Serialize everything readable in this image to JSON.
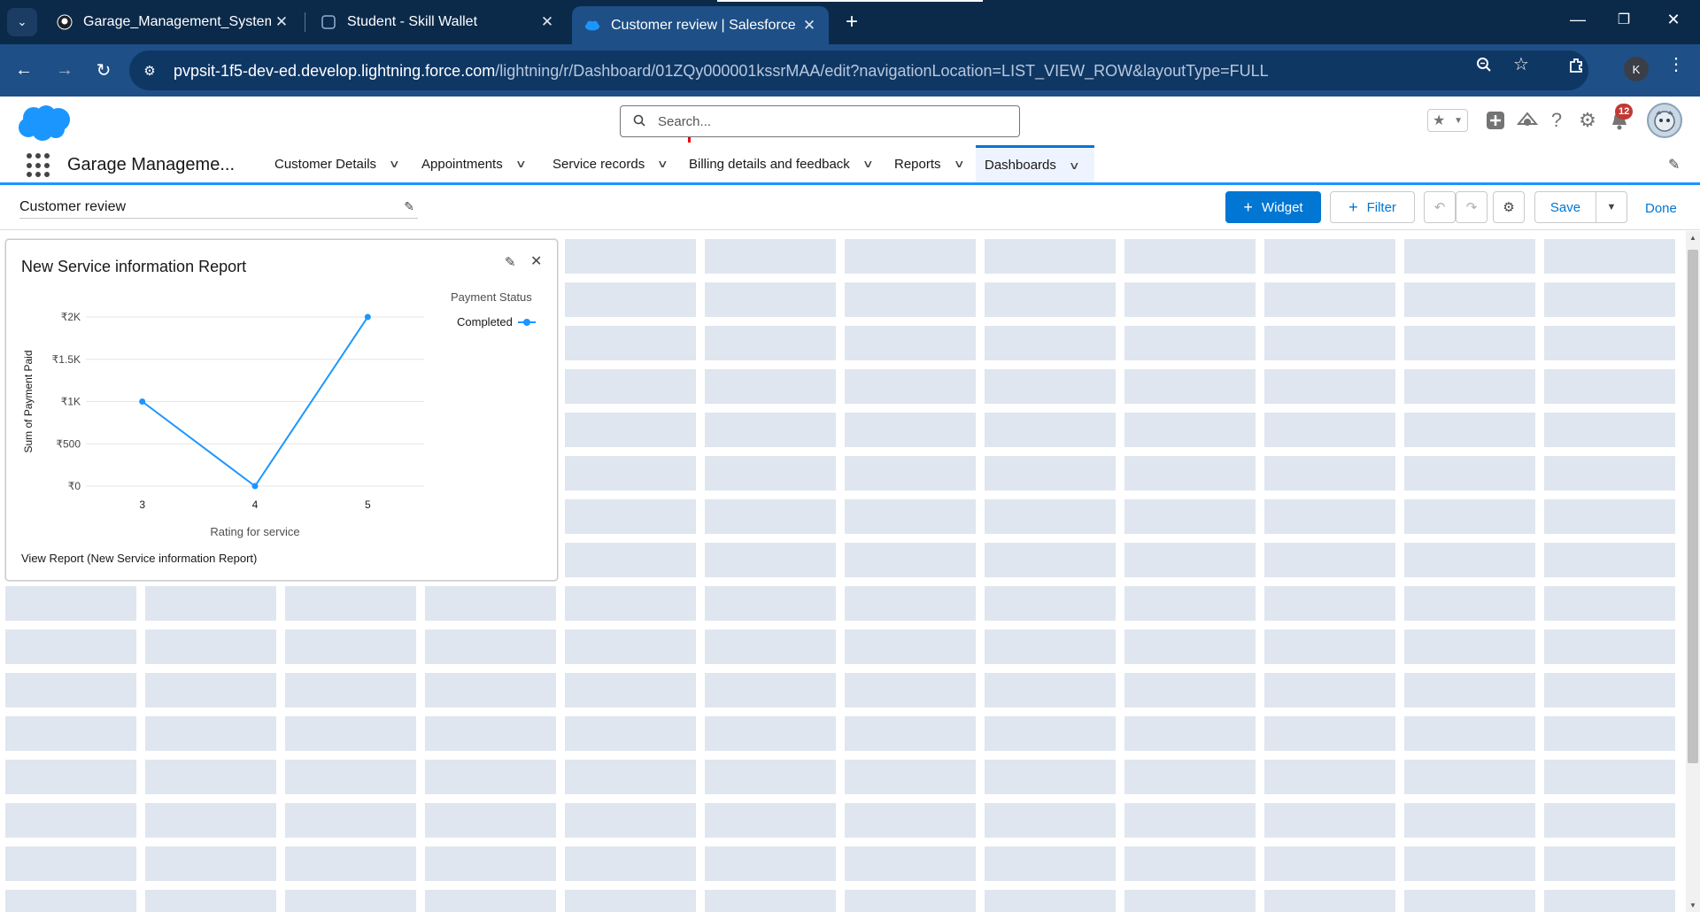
{
  "browser": {
    "tabs": [
      {
        "title": "Garage_Management_System_S",
        "icon": "github-icon"
      },
      {
        "title": "Student - Skill Wallet",
        "icon": "page-icon"
      },
      {
        "title": "Customer review | Salesforce",
        "icon": "salesforce-cloud-icon"
      }
    ],
    "url_host": "pvpsit-1f5-dev-ed.develop.lightning.force.com",
    "url_path": "/lightning/r/Dashboard/01ZQy000001kssrMAA/edit?navigationLocation=LIST_VIEW_ROW&layoutType=FULL",
    "profile_initial": "K"
  },
  "header": {
    "search_placeholder": "Search...",
    "notifications_count": "12"
  },
  "nav": {
    "app_name": "Garage Manageme...",
    "items": [
      {
        "label": "Customer Details"
      },
      {
        "label": "Appointments"
      },
      {
        "label": "Service records"
      },
      {
        "label": "Billing details and feedback"
      },
      {
        "label": "Reports"
      },
      {
        "label": "Dashboards"
      }
    ]
  },
  "builder": {
    "dashboard_name": "Customer review",
    "widget_label": "Widget",
    "filter_label": "Filter",
    "save_label": "Save",
    "done_label": "Done"
  },
  "widget": {
    "title": "New Service information Report",
    "footer": "View Report (New Service information Report)",
    "legend_title": "Payment Status",
    "legend_item": "Completed"
  },
  "chart_data": {
    "type": "line",
    "x": [
      3,
      4,
      5
    ],
    "series": [
      {
        "name": "Completed",
        "values": [
          1000,
          0,
          2000
        ],
        "color": "#1b96ff"
      }
    ],
    "xlabel": "Rating for service",
    "ylabel": "Sum of Payment Paid",
    "y_ticks": [
      {
        "value": 0,
        "label": "₹0"
      },
      {
        "value": 500,
        "label": "₹500"
      },
      {
        "value": 1000,
        "label": "₹1K"
      },
      {
        "value": 1500,
        "label": "₹1.5K"
      },
      {
        "value": 2000,
        "label": "₹2K"
      }
    ],
    "ylim": [
      0,
      2000
    ],
    "grid": true,
    "legend_position": "top-right"
  }
}
